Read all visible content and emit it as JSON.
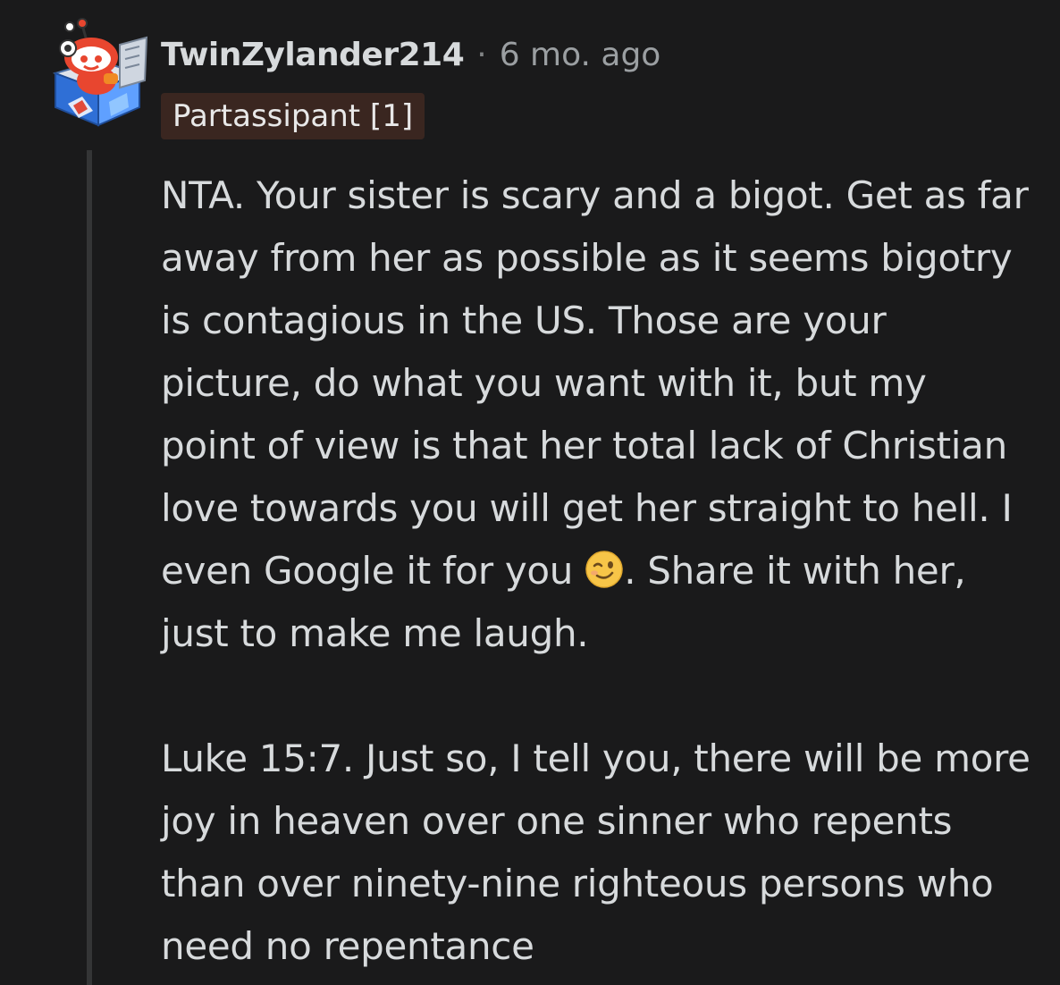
{
  "comment": {
    "author": "TwinZylander214",
    "separator": "·",
    "timestamp": "6 mo. ago",
    "flair": "Partassipant [1]",
    "paragraph1_before_emoji": "NTA. Your sister is scary and a bigot. Get as far away from her as possible as it seems bigotry is contagious in the US. Those are your picture, do what you want with it, but my point of view is that her total lack of Christian love towards you will get her straight to hell. I even Google it for you ",
    "paragraph1_emoji": "winking-face",
    "paragraph1_after_emoji": ". Share it with her, just to make me laugh.",
    "paragraph2": "Luke 15:7. Just so, I tell you, there will be more joy in heaven over one sinner who repents than over ninety-nine righteous persons who need no repentance"
  },
  "colors": {
    "background": "#1a1a1b",
    "text": "#d7dadc",
    "muted": "#9b9fa2",
    "flair_bg": "#3a2620",
    "thread_line": "#343536"
  }
}
